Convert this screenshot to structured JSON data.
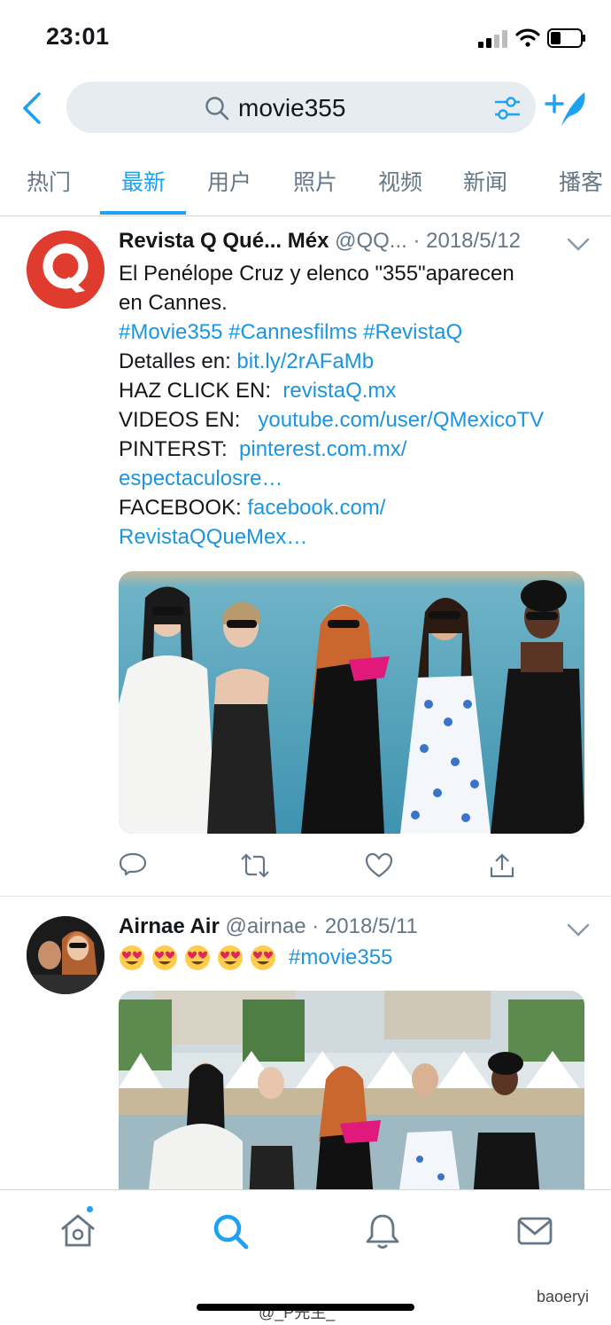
{
  "status_bar": {
    "time": "23:01"
  },
  "search": {
    "query": "movie355"
  },
  "tabs": [
    {
      "label": "热门"
    },
    {
      "label": "最新"
    },
    {
      "label": "用户"
    },
    {
      "label": "照片"
    },
    {
      "label": "视频"
    },
    {
      "label": "新闻"
    },
    {
      "label": "播客"
    }
  ],
  "active_tab": "最新",
  "tweets": [
    {
      "author": "Revista Q Qué... Méx",
      "handle": "@QQ...",
      "date": "2018/5/12",
      "lines": {
        "l1": "El Penélope Cruz y elenco \"355\"aparecen",
        "l2": "en Cannes.",
        "hashtags": "#Movie355 #Cannesfilms #RevistaQ",
        "detalles_label": "Detalles en: ",
        "detalles_link": "bit.ly/2rAFaMb",
        "haz_label": "HAZ CLICK EN:  ",
        "haz_link": "revistaQ.mx",
        "videos_label": "VIDEOS EN:   ",
        "videos_link": "youtube.com/user/QMexicoTV",
        "pinterest_label": "PINTERST:  ",
        "pinterest_link": "pinterest.com.mx/",
        "pinterest_link2": "espectaculosre…",
        "facebook_label": "FACEBOOK: ",
        "facebook_link": "facebook.com/",
        "facebook_link2": "RevistaQQueMex…"
      }
    },
    {
      "author": "Airnae Air",
      "handle": "@airnae",
      "date": "2018/5/11",
      "hashtag": "#movie355"
    }
  ],
  "separator_dot": "·",
  "watermarks": {
    "weibo": "@_P先生_",
    "wechat": "baoeryi"
  },
  "colors": {
    "accent": "#1da1f2",
    "link": "#1b95e0",
    "brand_red": "#e03b2f"
  },
  "icons": [
    "back-icon",
    "search-icon",
    "filter-icon",
    "compose-icon",
    "chevron-down-icon",
    "reply-icon",
    "retweet-icon",
    "like-icon",
    "share-icon",
    "home-icon",
    "notifications-icon",
    "messages-icon"
  ]
}
